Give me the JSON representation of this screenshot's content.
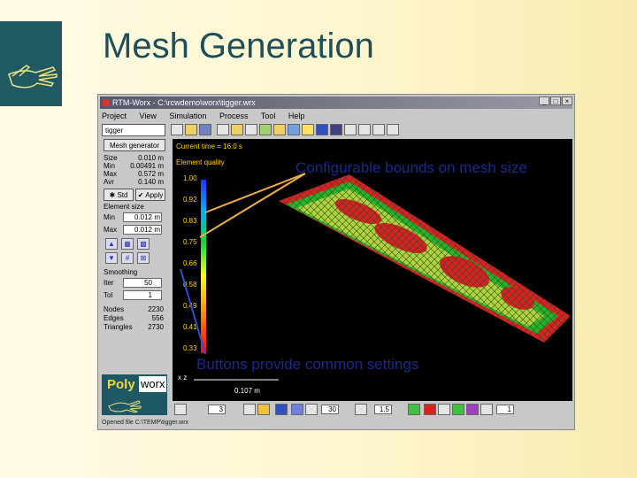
{
  "slide": {
    "title": "Mesh Generation"
  },
  "window": {
    "title": "RTM-Worx - C:\\rcwdemo\\worx\\tigger.wrx",
    "controls": [
      "_",
      "□",
      "×"
    ]
  },
  "menu": [
    "Project",
    "View",
    "Simulation",
    "Process",
    "Tool",
    "Help"
  ],
  "toolbar": {
    "combo_value": "tigger"
  },
  "left_panel": {
    "mode_button": "Mesh generator",
    "stats": [
      {
        "label": "Size",
        "value": "0.010 m"
      },
      {
        "label": "Min",
        "value": "0.00491 m"
      },
      {
        "label": "Max",
        "value": "0.572 m"
      },
      {
        "label": "Avr",
        "value": "0.140 m"
      }
    ],
    "std_button": "Std",
    "apply_button": "Apply",
    "element_size_label": "Element size",
    "min_label": "Min",
    "min_value": "0.012",
    "min_unit": "m",
    "max_label": "Max",
    "max_value": "0.012",
    "max_unit": "m",
    "smoothing_label": "Smoothing",
    "iter_label": "Iter",
    "iter_value": "50",
    "tol_label": "Tol",
    "tol_value": "1",
    "counts": [
      {
        "label": "Nodes",
        "value": "2230"
      },
      {
        "label": "Edges",
        "value": "556"
      },
      {
        "label": "Triangles",
        "value": "2730"
      }
    ]
  },
  "logo": {
    "part1": "Poly",
    "part2": "worx"
  },
  "viewport": {
    "current_time": "Current time = 16.0 s",
    "legend_title": "Element quality",
    "legend_values": [
      "1.00",
      "0.92",
      "0.83",
      "0.75",
      "0.66",
      "0.58",
      "0.49",
      "0.41",
      "0.33"
    ],
    "scale_label": "0.107 m"
  },
  "bottom_toolbar": {
    "field1": "3",
    "field2": "30",
    "field3": "1.5",
    "field4": "1"
  },
  "status_bar": {
    "text": "Opened file C:\\TEMP\\tigger.wrx"
  },
  "annotations": {
    "top": "Configurable bounds on mesh size",
    "bottom": "Buttons provide common settings"
  },
  "colors": {
    "logo_teal": "#1f5a63",
    "title": "#1f4e59",
    "annotation_text": "#1a2a8a",
    "arrow": "#f0b040",
    "legend_text": "#ffd400"
  }
}
